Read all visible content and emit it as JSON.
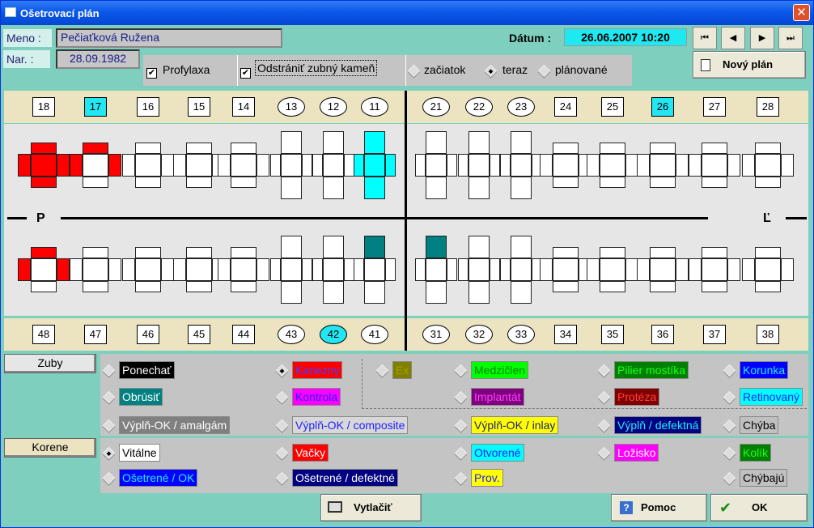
{
  "window": {
    "title": "Ošetrovací plán",
    "close_glyph": "✕"
  },
  "patient": {
    "name_label": "Meno :",
    "name_value": "Pečiaťková Ružena",
    "birth_label": "Nar. :",
    "birth_value": "28.09.1982"
  },
  "date": {
    "label": "Dátum :",
    "value": "26.06.2007 10:20"
  },
  "nav": {
    "first": "⏮",
    "prev": "◀",
    "next": "▶",
    "last": "⏭"
  },
  "new_plan": {
    "label": "Nový plán",
    "icon": "document-icon"
  },
  "options": {
    "profylaxa": {
      "label": "Profylaxa",
      "checked": true
    },
    "odstranit": {
      "label": "Odstrániť zubný kameň",
      "checked": true
    },
    "period": [
      {
        "label": "začiatok",
        "selected": false
      },
      {
        "label": "teraz",
        "selected": true
      },
      {
        "label": "plánované",
        "selected": false
      }
    ]
  },
  "teeth": {
    "upper_numbers": [
      {
        "n": "18",
        "shape": "box",
        "highlight": false
      },
      {
        "n": "17",
        "shape": "box",
        "highlight": true
      },
      {
        "n": "16",
        "shape": "box",
        "highlight": false
      },
      {
        "n": "15",
        "shape": "box",
        "highlight": false
      },
      {
        "n": "14",
        "shape": "box",
        "highlight": false
      },
      {
        "n": "13",
        "shape": "oval",
        "highlight": false
      },
      {
        "n": "12",
        "shape": "oval",
        "highlight": false
      },
      {
        "n": "11",
        "shape": "oval",
        "highlight": false
      },
      {
        "n": "21",
        "shape": "oval",
        "highlight": false
      },
      {
        "n": "22",
        "shape": "oval",
        "highlight": false
      },
      {
        "n": "23",
        "shape": "oval",
        "highlight": false
      },
      {
        "n": "24",
        "shape": "box",
        "highlight": false
      },
      {
        "n": "25",
        "shape": "box",
        "highlight": false
      },
      {
        "n": "26",
        "shape": "box",
        "highlight": true
      },
      {
        "n": "27",
        "shape": "box",
        "highlight": false
      },
      {
        "n": "28",
        "shape": "box",
        "highlight": false
      }
    ],
    "lower_numbers": [
      {
        "n": "48",
        "shape": "box",
        "highlight": false
      },
      {
        "n": "47",
        "shape": "box",
        "highlight": false
      },
      {
        "n": "46",
        "shape": "box",
        "highlight": false
      },
      {
        "n": "45",
        "shape": "box",
        "highlight": false
      },
      {
        "n": "44",
        "shape": "box",
        "highlight": false
      },
      {
        "n": "43",
        "shape": "oval",
        "highlight": false
      },
      {
        "n": "42",
        "shape": "oval",
        "highlight": true
      },
      {
        "n": "41",
        "shape": "oval",
        "highlight": false
      },
      {
        "n": "31",
        "shape": "oval",
        "highlight": false
      },
      {
        "n": "32",
        "shape": "oval",
        "highlight": false
      },
      {
        "n": "33",
        "shape": "oval",
        "highlight": false
      },
      {
        "n": "34",
        "shape": "box",
        "highlight": false
      },
      {
        "n": "35",
        "shape": "box",
        "highlight": false
      },
      {
        "n": "36",
        "shape": "box",
        "highlight": false
      },
      {
        "n": "37",
        "shape": "box",
        "highlight": false
      },
      {
        "n": "38",
        "shape": "box",
        "highlight": false
      }
    ],
    "side_left": "P",
    "side_right": "Ľ",
    "upper_states": {
      "18": "all-red",
      "17": "partial-red",
      "11": "all-cyan"
    },
    "lower_states": {
      "48": "partial-red",
      "41": "top-teal",
      "31": "top-teal"
    },
    "colors": {
      "red": "#ff0000",
      "cyan": "#00ffff",
      "teal": "#008080"
    }
  },
  "legend": {
    "zuby_label": "Zuby",
    "korene_label": "Korene",
    "zuby_items": [
      {
        "label": "Ponechať",
        "bg": "#000000",
        "fg": "#ffffff",
        "selected": false
      },
      {
        "label": "Kariezny",
        "bg": "#ff0000",
        "fg": "#4040ff",
        "selected": true
      },
      {
        "label": "Ex",
        "bg": "#808000",
        "fg": "#a0a000",
        "selected": false
      },
      {
        "label": "Medzičlen",
        "bg": "#00ff00",
        "fg": "#008000",
        "selected": false
      },
      {
        "label": "Pilier mostíka",
        "bg": "#008000",
        "fg": "#20ff20",
        "selected": false
      },
      {
        "label": "Korunka",
        "bg": "#0000ff",
        "fg": "#20f0ff",
        "selected": false
      },
      {
        "label": "Obrúsiť",
        "bg": "#008080",
        "fg": "#ffffff",
        "selected": false
      },
      {
        "label": "Kontrola",
        "bg": "#ff00ff",
        "fg": "#2020ff",
        "selected": false
      },
      {
        "label": "Implantát",
        "bg": "#800080",
        "fg": "#ff40ff",
        "selected": false
      },
      {
        "label": "Protéza",
        "bg": "#800000",
        "fg": "#ff4040",
        "selected": false
      },
      {
        "label": "Retinovaný",
        "bg": "#00ffff",
        "fg": "#2020ff",
        "selected": false
      },
      {
        "label": "Výplň-OK / amalgám",
        "bg": "#808080",
        "fg": "#ffffff",
        "selected": false
      },
      {
        "label": "Výplň-OK / composite",
        "bg": "#d8d8d8",
        "fg": "#2020ff",
        "selected": false
      },
      {
        "label": "Výplň-OK / inlay",
        "bg": "#ffff00",
        "fg": "#202080",
        "selected": false
      },
      {
        "label": "Výplň / defektná",
        "bg": "#000080",
        "fg": "#20f0ff",
        "selected": false
      },
      {
        "label": "Chýba",
        "bg": "#c0c0c0",
        "fg": "#000000",
        "selected": false
      }
    ],
    "korene_items": [
      {
        "label": "Vitálne",
        "bg": "#ffffff",
        "fg": "#000000",
        "selected": true
      },
      {
        "label": "Vačky",
        "bg": "#ff0000",
        "fg": "#ffffff",
        "selected": false
      },
      {
        "label": "Otvorené",
        "bg": "#00ffff",
        "fg": "#2020ff",
        "selected": false
      },
      {
        "label": "Ložisko",
        "bg": "#ff00ff",
        "fg": "#ffffff",
        "selected": false
      },
      {
        "label": "Kolík",
        "bg": "#008000",
        "fg": "#20ff20",
        "selected": false
      },
      {
        "label": "Ošetrené / OK",
        "bg": "#0000ff",
        "fg": "#20f0ff",
        "selected": false
      },
      {
        "label": "Ošetrené / defektné",
        "bg": "#000080",
        "fg": "#ffffff",
        "selected": false
      },
      {
        "label": "Prov.",
        "bg": "#ffff00",
        "fg": "#2020ff",
        "selected": false
      },
      {
        "label": "Chýbajú",
        "bg": "#c0c0c0",
        "fg": "#000000",
        "selected": false
      }
    ]
  },
  "buttons": {
    "print": "Vytlačiť",
    "help": "Pomoc",
    "ok": "OK",
    "help_glyph": "?",
    "ok_glyph": "✔"
  }
}
